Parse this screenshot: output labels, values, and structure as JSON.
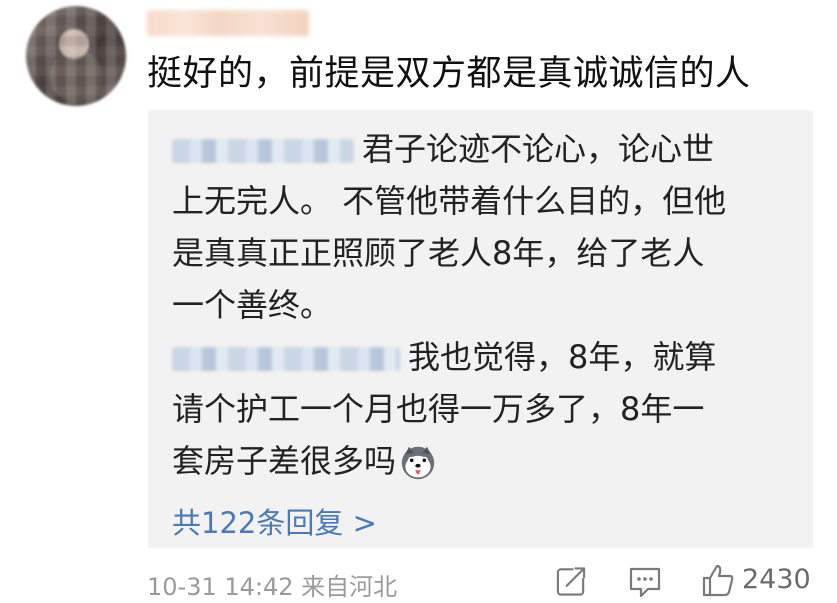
{
  "comment": {
    "text": "挺好的，前提是双方都是真诚诚信的人",
    "footer": {
      "timestamp": "10-31 14:42",
      "location": "来自河北"
    },
    "like_count": "2430"
  },
  "replies": [
    {
      "lines": [
        "君子论迹不论心，论心世",
        "上无完人。 不管他带着什么目的，但他",
        "是真真正正照顾了老人8年，给了老人",
        "一个善终。"
      ]
    },
    {
      "lines": [
        "我也觉得，8年，就算",
        "请个护工一个月也得一万多了，8年一",
        "套房子差很多吗"
      ],
      "emoji": "husky-dog-emoji"
    }
  ],
  "more_replies_label": "共122条回复 >",
  "icons": [
    "share-icon",
    "comment-icon",
    "like-icon"
  ],
  "colors": {
    "link": "#4a79b7",
    "reply_bg": "#f2f2f2",
    "meta": "#9a9a9a"
  }
}
